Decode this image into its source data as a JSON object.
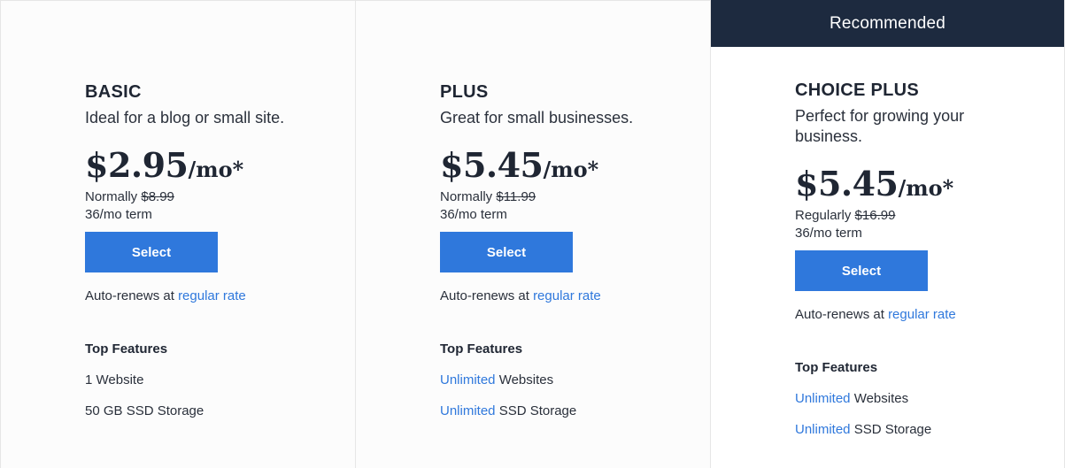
{
  "plans": [
    {
      "name": "BASIC",
      "description": "Ideal for a blog or small site.",
      "price": "$2.95",
      "unit": "/mo*",
      "normally_label": "Normally",
      "normal_price": "$8.99",
      "term": "36/mo term",
      "select_label": "Select",
      "renew_prefix": "Auto-renews at",
      "renew_link": "regular rate",
      "features_title": "Top Features",
      "features": [
        {
          "highlight": "",
          "text": "1 Website"
        },
        {
          "highlight": "",
          "text": "50 GB SSD Storage"
        }
      ]
    },
    {
      "name": "PLUS",
      "description": "Great for small businesses.",
      "price": "$5.45",
      "unit": "/mo*",
      "normally_label": "Normally",
      "normal_price": "$11.99",
      "term": "36/mo term",
      "select_label": "Select",
      "renew_prefix": "Auto-renews at",
      "renew_link": "regular rate",
      "features_title": "Top Features",
      "features": [
        {
          "highlight": "Unlimited",
          "text": " Websites"
        },
        {
          "highlight": "Unlimited",
          "text": " SSD Storage"
        }
      ]
    },
    {
      "recommended": "Recommended",
      "name": "CHOICE PLUS",
      "description": "Perfect for growing your business.",
      "price": "$5.45",
      "unit": "/mo*",
      "normally_label": "Regularly",
      "normal_price": "$16.99",
      "term": "36/mo term",
      "select_label": "Select",
      "renew_prefix": "Auto-renews at",
      "renew_link": "regular rate",
      "features_title": "Top Features",
      "features": [
        {
          "highlight": "Unlimited",
          "text": " Websites"
        },
        {
          "highlight": "Unlimited",
          "text": " SSD Storage"
        }
      ]
    }
  ],
  "colors": {
    "accent": "#2f78dc",
    "banner": "#1d2a3f",
    "text": "#1f2633"
  }
}
